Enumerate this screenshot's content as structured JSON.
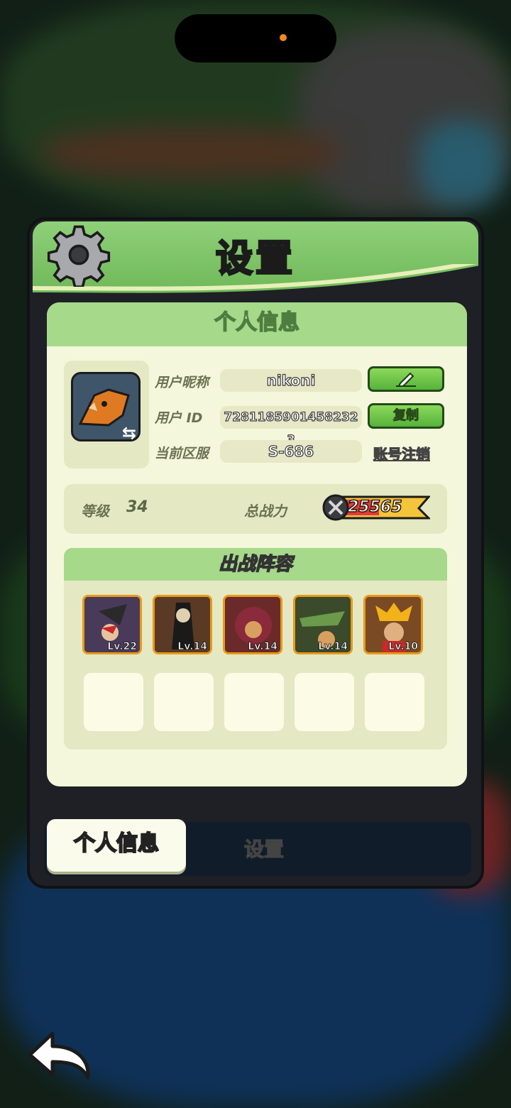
{
  "panel": {
    "title": "设置",
    "section_title": "个人信息",
    "profile": {
      "nickname_label": "用户昵称",
      "nickname": "nikoni",
      "id_label": "用户  ID",
      "user_id": "7281185901458232 3",
      "server_label": "当前区服",
      "server": "S-686",
      "copy_button": "复制",
      "delete_account_link": "账号注销"
    },
    "stats": {
      "level_label": "等级",
      "level": "34",
      "power_label": "总战力",
      "power": "25565"
    },
    "lineup": {
      "title": "出战阵容",
      "heroes": [
        {
          "level": "Lv.22"
        },
        {
          "level": "Lv.14"
        },
        {
          "level": "Lv.14"
        },
        {
          "level": "Lv.14"
        },
        {
          "level": "Lv.10"
        }
      ]
    },
    "tabs": {
      "active": "个人信息",
      "other": "设置"
    }
  },
  "colors": {
    "header_green": "#7cc464",
    "card_bg": "#f5f7dc",
    "button_green": "#56b33b",
    "hero_border": "#e89a1a"
  },
  "icons": [
    "gear-icon",
    "edit-pencil-icon",
    "swap-arrows-icon",
    "sword-power-icon",
    "back-arrow-icon"
  ]
}
